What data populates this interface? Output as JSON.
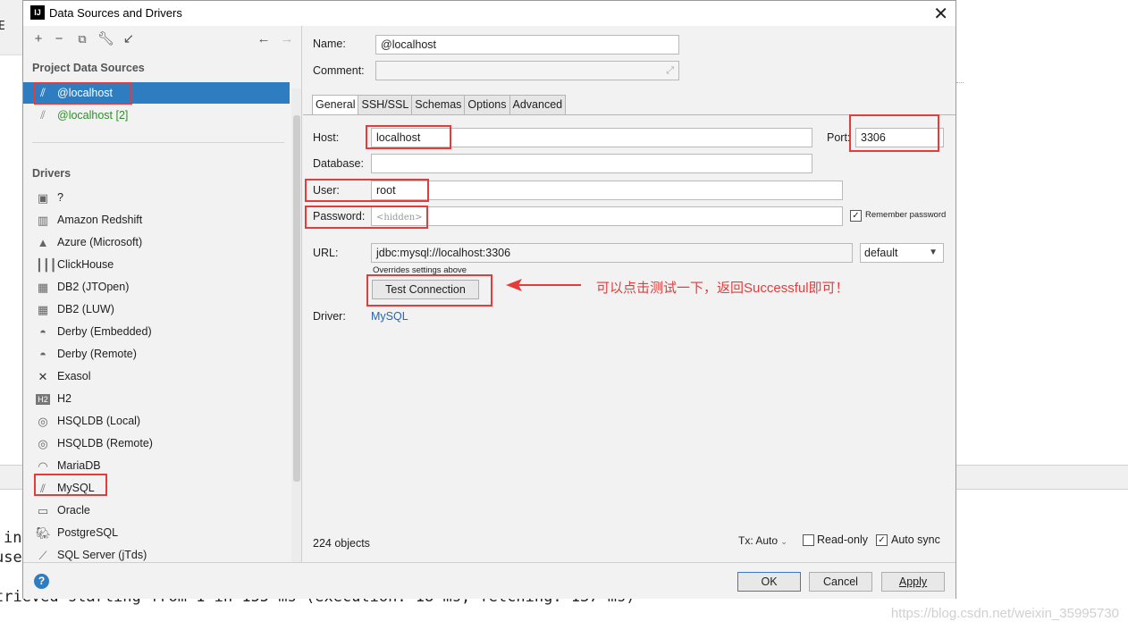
{
  "dialog": {
    "title": "Data Sources and Drivers",
    "app_icon": "IJ"
  },
  "left": {
    "project_title": "Project Data Sources",
    "data_sources": [
      {
        "label": "@localhost"
      },
      {
        "label": "@localhost [2]"
      }
    ],
    "drivers_title": "Drivers",
    "drivers": [
      {
        "label": "?",
        "icon": "unknown-driver-icon"
      },
      {
        "label": "Amazon Redshift",
        "icon": "redshift-icon"
      },
      {
        "label": "Azure (Microsoft)",
        "icon": "azure-icon"
      },
      {
        "label": "ClickHouse",
        "icon": "clickhouse-icon"
      },
      {
        "label": "DB2 (JTOpen)",
        "icon": "db2-icon"
      },
      {
        "label": "DB2 (LUW)",
        "icon": "db2-icon"
      },
      {
        "label": "Derby (Embedded)",
        "icon": "derby-icon"
      },
      {
        "label": "Derby (Remote)",
        "icon": "derby-icon"
      },
      {
        "label": "Exasol",
        "icon": "exasol-icon"
      },
      {
        "label": "H2",
        "icon": "h2-icon"
      },
      {
        "label": "HSQLDB (Local)",
        "icon": "hsqldb-icon"
      },
      {
        "label": "HSQLDB (Remote)",
        "icon": "hsqldb-icon"
      },
      {
        "label": "MariaDB",
        "icon": "mariadb-icon"
      },
      {
        "label": "MySQL",
        "icon": "mysql-icon"
      },
      {
        "label": "Oracle",
        "icon": "oracle-icon"
      },
      {
        "label": "PostgreSQL",
        "icon": "postgresql-icon"
      },
      {
        "label": "SQL Server (jTds)",
        "icon": "sqlserver-icon"
      }
    ]
  },
  "form": {
    "name_label": "Name:",
    "name_value": "@localhost",
    "comment_label": "Comment:",
    "tabs": [
      "General",
      "SSH/SSL",
      "Schemas",
      "Options",
      "Advanced"
    ],
    "host_label": "Host:",
    "host_value": "localhost",
    "port_label": "Port:",
    "port_value": "3306",
    "database_label": "Database:",
    "user_label": "User:",
    "user_value": "root",
    "password_label": "Password:",
    "password_placeholder": "<hidden>",
    "remember_label": "Remember password",
    "url_label": "URL:",
    "url_value": "jdbc:mysql://localhost:3306",
    "url_mode": "default",
    "overrides_note": "Overrides settings above",
    "test_button": "Test Connection",
    "driver_label": "Driver:",
    "driver_value": "MySQL",
    "objects_count": "224 objects",
    "tx_label": "Tx: Auto",
    "readonly_label": "Read-only",
    "autosync_label": "Auto sync"
  },
  "buttons": {
    "ok": "OK",
    "cancel": "Cancel",
    "apply": "Apply"
  },
  "annotation": {
    "text": "可以点击测试一下，返回Successful即可！",
    "color": "#e63b3b"
  },
  "background": {
    "line1": "in",
    "line2": "use",
    "line3": "trieved starting from 1 in 155 ms (execution: 18 ms, fetching: 137 ms)",
    "watermark": "https://blog.csdn.net/weixin_35995730",
    "corner_text": "E"
  },
  "colors": {
    "selection": "#2f7dc1",
    "link": "#2466b8",
    "annotation_red": "#e63b3b"
  }
}
